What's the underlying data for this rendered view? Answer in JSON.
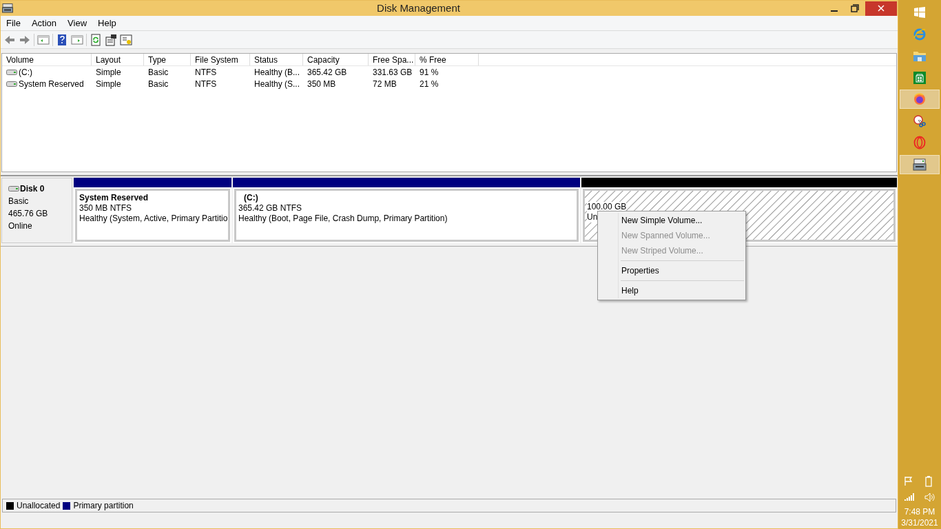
{
  "window": {
    "title": "Disk Management"
  },
  "menu": [
    "File",
    "Action",
    "View",
    "Help"
  ],
  "volumes": {
    "columns": [
      "Volume",
      "Layout",
      "Type",
      "File System",
      "Status",
      "Capacity",
      "Free Spa...",
      "% Free"
    ],
    "rows": [
      [
        "(C:)",
        "Simple",
        "Basic",
        "NTFS",
        "Healthy (B...",
        "365.42 GB",
        "331.63 GB",
        "91 %"
      ],
      [
        "System Reserved",
        "Simple",
        "Basic",
        "NTFS",
        "Healthy (S...",
        "350 MB",
        "72 MB",
        "21 %"
      ]
    ]
  },
  "disk": {
    "name": "Disk 0",
    "type": "Basic",
    "size": "465.76 GB",
    "status": "Online",
    "partitions": [
      {
        "kind": "primary",
        "color": "#000080",
        "name": "System Reserved",
        "size": "350 MB NTFS",
        "status": "Healthy (System, Active, Primary Partitio"
      },
      {
        "kind": "primary",
        "color": "#000080",
        "name": "(C:)",
        "size": "365.42 GB NTFS",
        "status": "Healthy (Boot, Page File, Crash Dump, Primary Partition)"
      },
      {
        "kind": "unallocated",
        "color": "#000000",
        "size": "100.00 GB",
        "status": "Un"
      }
    ]
  },
  "context_menu": [
    {
      "kind": "item",
      "label": "New Simple Volume...",
      "disabled": false
    },
    {
      "kind": "item",
      "label": "New Spanned Volume...",
      "disabled": true
    },
    {
      "kind": "item",
      "label": "New Striped Volume...",
      "disabled": true
    },
    {
      "kind": "separator"
    },
    {
      "kind": "item",
      "label": "Properties",
      "disabled": false
    },
    {
      "kind": "separator"
    },
    {
      "kind": "item",
      "label": "Help",
      "disabled": false
    }
  ],
  "legend": [
    {
      "label": "Unallocated",
      "color": "#000000"
    },
    {
      "label": "Primary partition",
      "color": "#000080"
    }
  ],
  "taskbar": {
    "items": [
      {
        "kind": "start",
        "selected": false
      },
      {
        "kind": "ie",
        "selected": false
      },
      {
        "kind": "explorer",
        "selected": false
      },
      {
        "kind": "store",
        "selected": false
      },
      {
        "kind": "firefox",
        "selected": true
      },
      {
        "kind": "snip",
        "selected": false
      },
      {
        "kind": "opera",
        "selected": false
      },
      {
        "kind": "disk",
        "selected": true
      }
    ],
    "time": "7:48 PM",
    "date": "3/31/2021"
  }
}
